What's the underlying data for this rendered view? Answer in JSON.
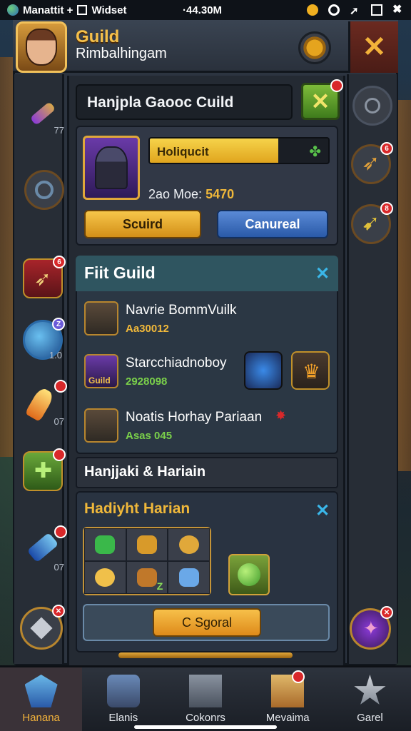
{
  "status_bar": {
    "left_text": "Manattit +",
    "widget_label": "Widset",
    "center_text": "·44.30M"
  },
  "header": {
    "title": "Guild",
    "subtitle": "Rimbalhingam"
  },
  "guild_name_banner": "Hanjpla Gaooc Cuild",
  "my_guild": {
    "bar_label": "Holiqucit",
    "bar_fill": 0.72,
    "stat_label": "2ao Moe: ",
    "stat_value": "5470",
    "btn_left": "Scuird",
    "btn_right": "Canureal"
  },
  "find_guild": {
    "title": "Fiit Guild",
    "rows": [
      {
        "name": "Navrie BommVuilk",
        "sub": "Aa30012",
        "sub_color": "#f0b83a"
      },
      {
        "name": "Starcchiadnoboy",
        "sub": "2928098",
        "sub_color": "#7ad04a",
        "icon_tag": "Guild"
      },
      {
        "name": "Noatis Horhay Pariaan",
        "sub": "Asas 045",
        "sub_color": "#7ad04a"
      }
    ]
  },
  "section_bar": "Hanjjaki & Hariain",
  "highlight": {
    "title": "Hadiyht Harian",
    "inv_qty": "Z",
    "cta": "C Sgoral"
  },
  "left_rail_counts": [
    "77",
    "1.0",
    "07",
    "07"
  ],
  "right_rail_badges": [
    "6",
    "8"
  ],
  "nav": [
    {
      "label": "Hanana",
      "active": true
    },
    {
      "label": "Elanis"
    },
    {
      "label": "Cokonrs"
    },
    {
      "label": "Mevaima"
    },
    {
      "label": "Garel"
    }
  ],
  "colors": {
    "gold": "#f5c04a",
    "accent_blue": "#3ab6e8",
    "badge_red": "#d9282a"
  }
}
